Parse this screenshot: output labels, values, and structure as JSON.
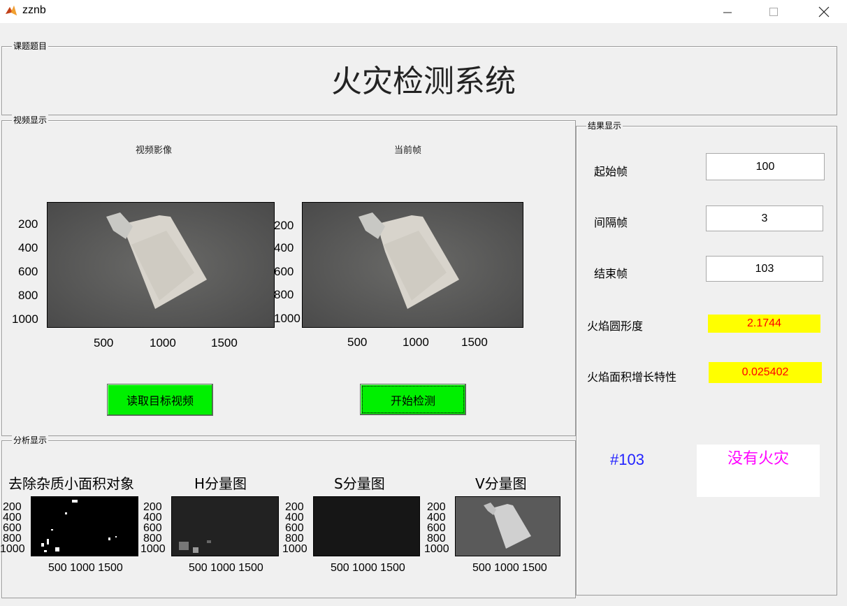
{
  "window": {
    "title": "zznb",
    "minimize": "—",
    "maximize": "☐",
    "close": "✕"
  },
  "panels": {
    "topic": "课题题目",
    "video": "视频显示",
    "analysis": "分析显示",
    "results": "结果显示"
  },
  "main_title": "火灾检测系统",
  "video": {
    "left_title": "视频影像",
    "right_title": "当前帧",
    "y_ticks": [
      "200",
      "400",
      "600",
      "800",
      "1000"
    ],
    "right_y_ticks": [
      "200",
      "400",
      "600",
      "800",
      "1000"
    ],
    "x_ticks": [
      "500",
      "1000",
      "1500"
    ],
    "read_button": "读取目标视频",
    "start_button": "开始检测"
  },
  "results": {
    "start_frame_label": "起始帧",
    "start_frame_value": "100",
    "interval_label": "间隔帧",
    "interval_value": "3",
    "end_frame_label": "结束帧",
    "end_frame_value": "103",
    "circularity_label": "火焰圆形度",
    "circularity_value": "2.1744",
    "area_growth_label": "火焰面积增长特性",
    "area_growth_value": "0.025402",
    "frame_number": "#103",
    "fire_status": "没有火灾",
    "colors": {
      "highlight": "#ffff00",
      "value_text": "#ff0000",
      "frame_text": "#2222ff",
      "status_text": "#ff00ff"
    }
  },
  "analysis": {
    "titles": [
      "去除杂质小面积对象",
      "H分量图",
      "S分量图",
      "V分量图"
    ],
    "y_ticks": [
      "200",
      "400",
      "600",
      "800",
      "1000"
    ],
    "x_ticks_text": "500 1000 1500"
  }
}
